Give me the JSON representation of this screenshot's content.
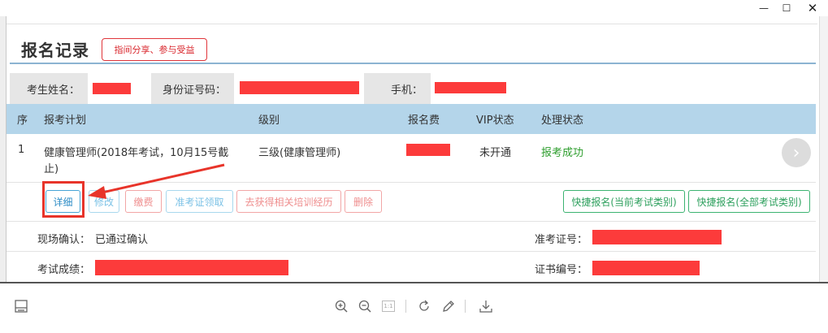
{
  "window": {
    "minimize_glyph": "—",
    "maximize_glyph": "☐",
    "close_glyph": "✕"
  },
  "page": {
    "title": "报名记录",
    "invite_button": "指间分享、参与受益"
  },
  "applicant": {
    "name_label": "考生姓名：",
    "id_label": "身份证号码：",
    "phone_label": "手机："
  },
  "table": {
    "headers": [
      "序",
      "报考计划",
      "级别",
      "报名费",
      "VIP状态",
      "处理状态"
    ],
    "row": {
      "index": "1",
      "plan_line1": "健康管理师(2018年考试，10月15号截",
      "plan_line2": "止)",
      "level": "三级(健康管理师)",
      "vip": "未开通",
      "status": "报考成功"
    }
  },
  "actions": {
    "detail": "详细",
    "edit": "修改",
    "pay": "缴费",
    "admission_ticket": "准考证领取",
    "training": "去获得相关培训经历",
    "delete": "删除",
    "quick_current": "快捷报名(当前考试类别)",
    "quick_all": "快捷报名(全部考试类别)"
  },
  "details": {
    "onsite_confirm_label": "现场确认：",
    "onsite_confirm_value": "已通过确认",
    "admission_no_label": "准考证号：",
    "score_label": "考试成绩：",
    "certificate_no_label": "证书编号："
  },
  "viewer_toolbar": {
    "icons": [
      "sidebar-icon",
      "zoom-in-icon",
      "zoom-out-icon",
      "actual-size-icon",
      "rotate-icon",
      "edit-icon",
      "download-icon"
    ],
    "actual_size_label": "1:1"
  },
  "colors": {
    "redaction": "#fc3b3b",
    "table_header": "#b4d5ea",
    "success": "#2e9e2e",
    "annotation_red": "#e8342a"
  }
}
